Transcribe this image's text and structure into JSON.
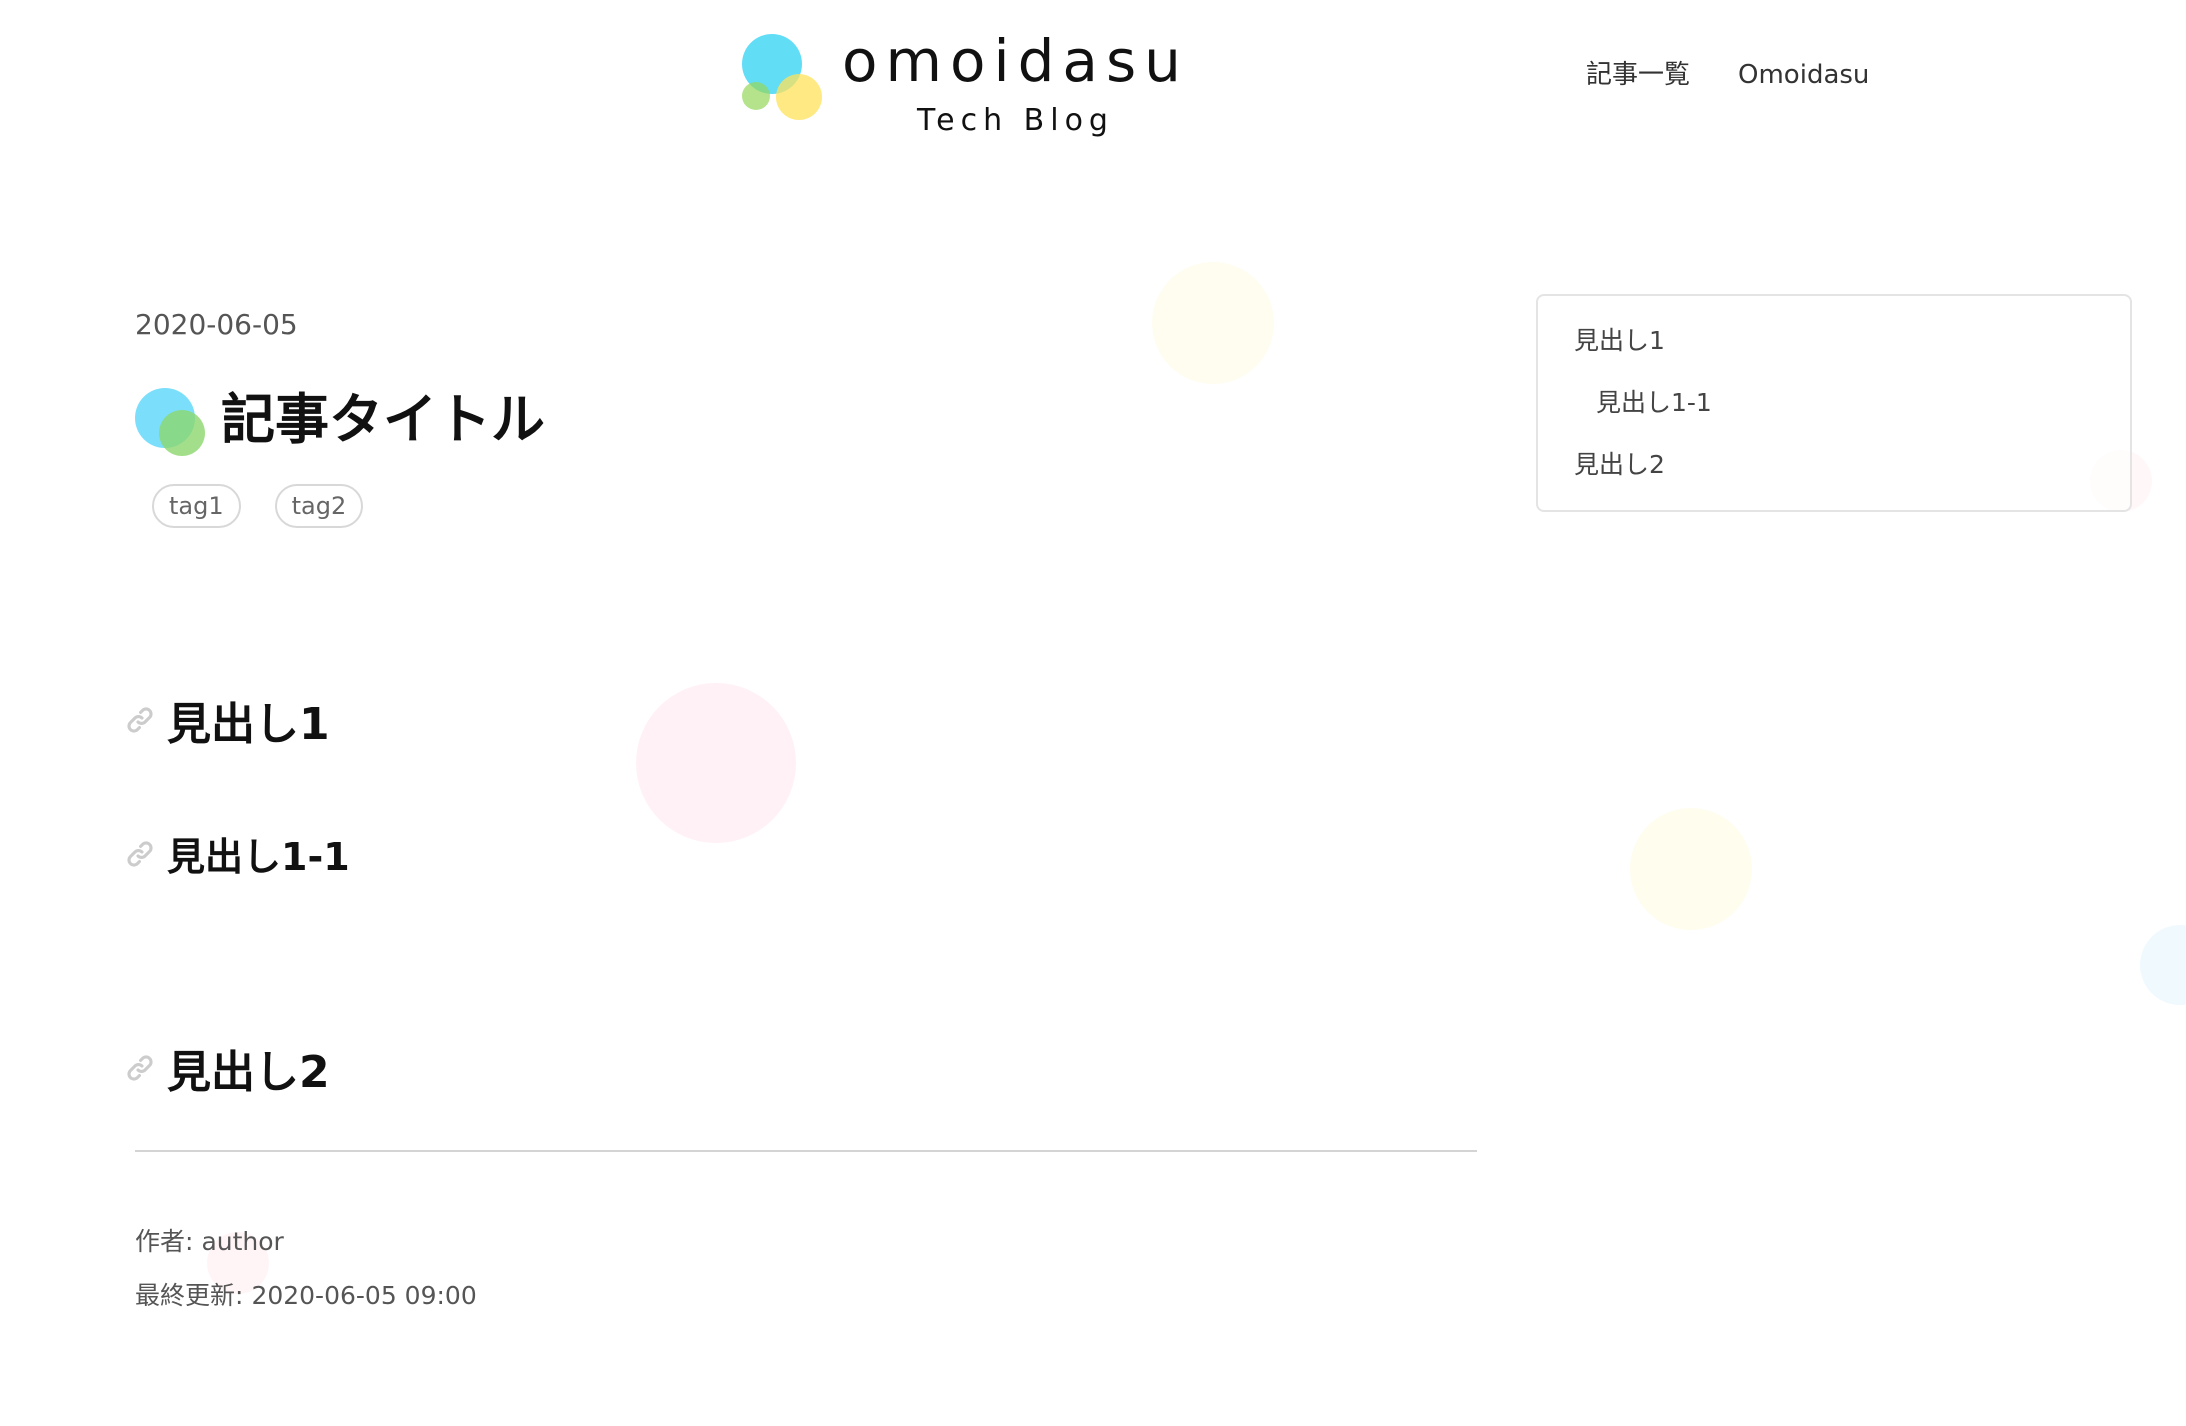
{
  "header": {
    "logo_title": "omoidasu",
    "logo_subtitle": "Tech Blog",
    "nav": [
      "記事一覧",
      "Omoidasu"
    ]
  },
  "article": {
    "date": "2020-06-05",
    "title": "記事タイトル",
    "tags": [
      "tag1",
      "tag2"
    ],
    "headings": [
      "見出し1",
      "見出し1-1",
      "見出し2"
    ],
    "author_label": "作者:",
    "author": "author",
    "updated_label": "最終更新:",
    "updated": "2020-06-05 09:00"
  },
  "toc": {
    "items": [
      "見出し1",
      "見出し1-1",
      "見出し2"
    ]
  },
  "colors": {
    "logo_blue": "#46d7f5",
    "logo_yellow": "#ffe15a",
    "logo_green": "#96d75a",
    "border": "#e4e4e4"
  },
  "icons": {
    "heading_anchor": "link-icon"
  }
}
